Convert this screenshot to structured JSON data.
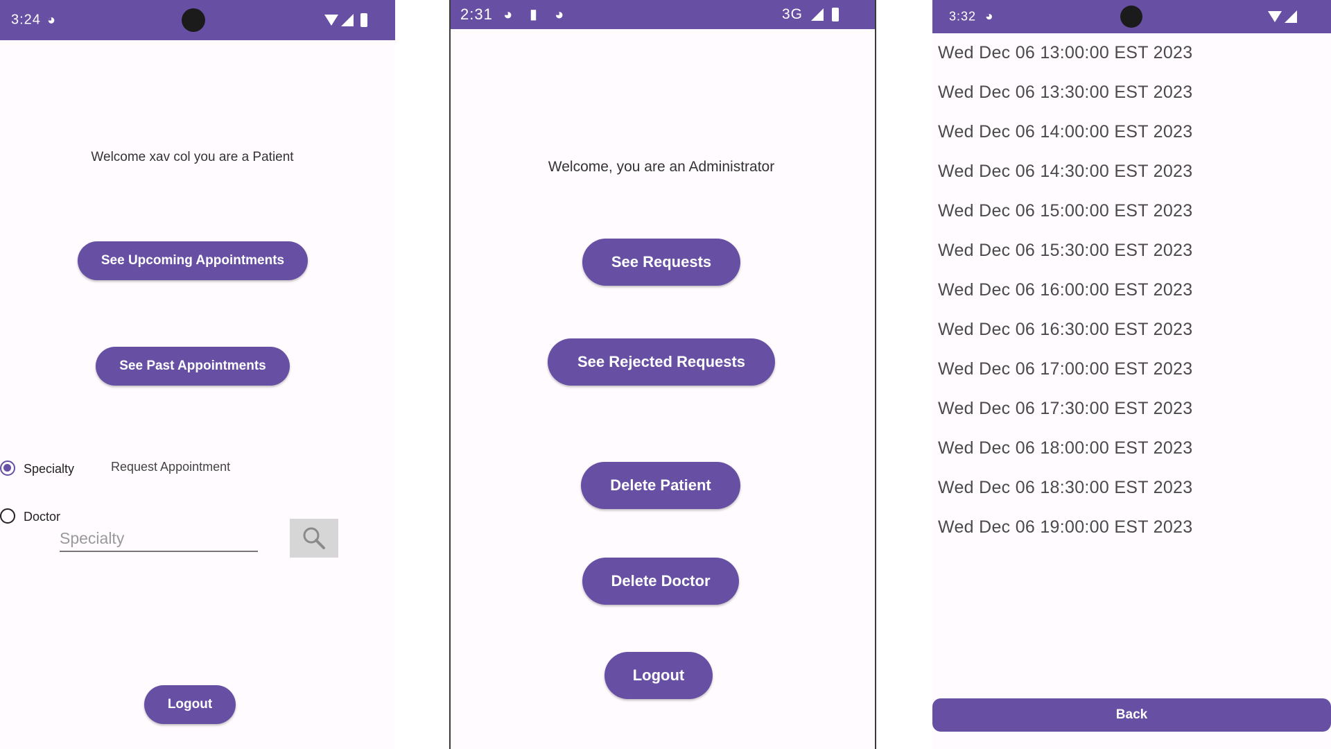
{
  "theme": {
    "primary": "#6750a4",
    "background": "#fffbfe"
  },
  "patient_screen": {
    "status_time": "3:24",
    "welcome": "Welcome xav col you are a Patient",
    "upcoming_button": "See Upcoming Appointments",
    "past_button": "See Past Appointments",
    "radio_specialty": "Specialty",
    "radio_doctor": "Doctor",
    "selected_radio": "Specialty",
    "request_label": "Request Appointment",
    "search_placeholder": "Specialty",
    "search_icon": "magnifier-icon",
    "logout_button": "Logout"
  },
  "admin_screen": {
    "status_time": "2:31",
    "network": "3G",
    "welcome": "Welcome, you are an Administrator",
    "buttons": [
      "See Requests",
      "See Rejected Requests",
      "Delete Patient",
      "Delete Doctor",
      "Logout"
    ]
  },
  "slots_screen": {
    "status_time": "3:32",
    "slots": [
      "Wed Dec 06 13:00:00 EST 2023",
      "Wed Dec 06 13:30:00 EST 2023",
      "Wed Dec 06 14:00:00 EST 2023",
      "Wed Dec 06 14:30:00 EST 2023",
      "Wed Dec 06 15:00:00 EST 2023",
      "Wed Dec 06 15:30:00 EST 2023",
      "Wed Dec 06 16:00:00 EST 2023",
      "Wed Dec 06 16:30:00 EST 2023",
      "Wed Dec 06 17:00:00 EST 2023",
      "Wed Dec 06 17:30:00 EST 2023",
      "Wed Dec 06 18:00:00 EST 2023",
      "Wed Dec 06 18:30:00 EST 2023",
      "Wed Dec 06 19:00:00 EST 2023"
    ],
    "back_button": "Back"
  }
}
